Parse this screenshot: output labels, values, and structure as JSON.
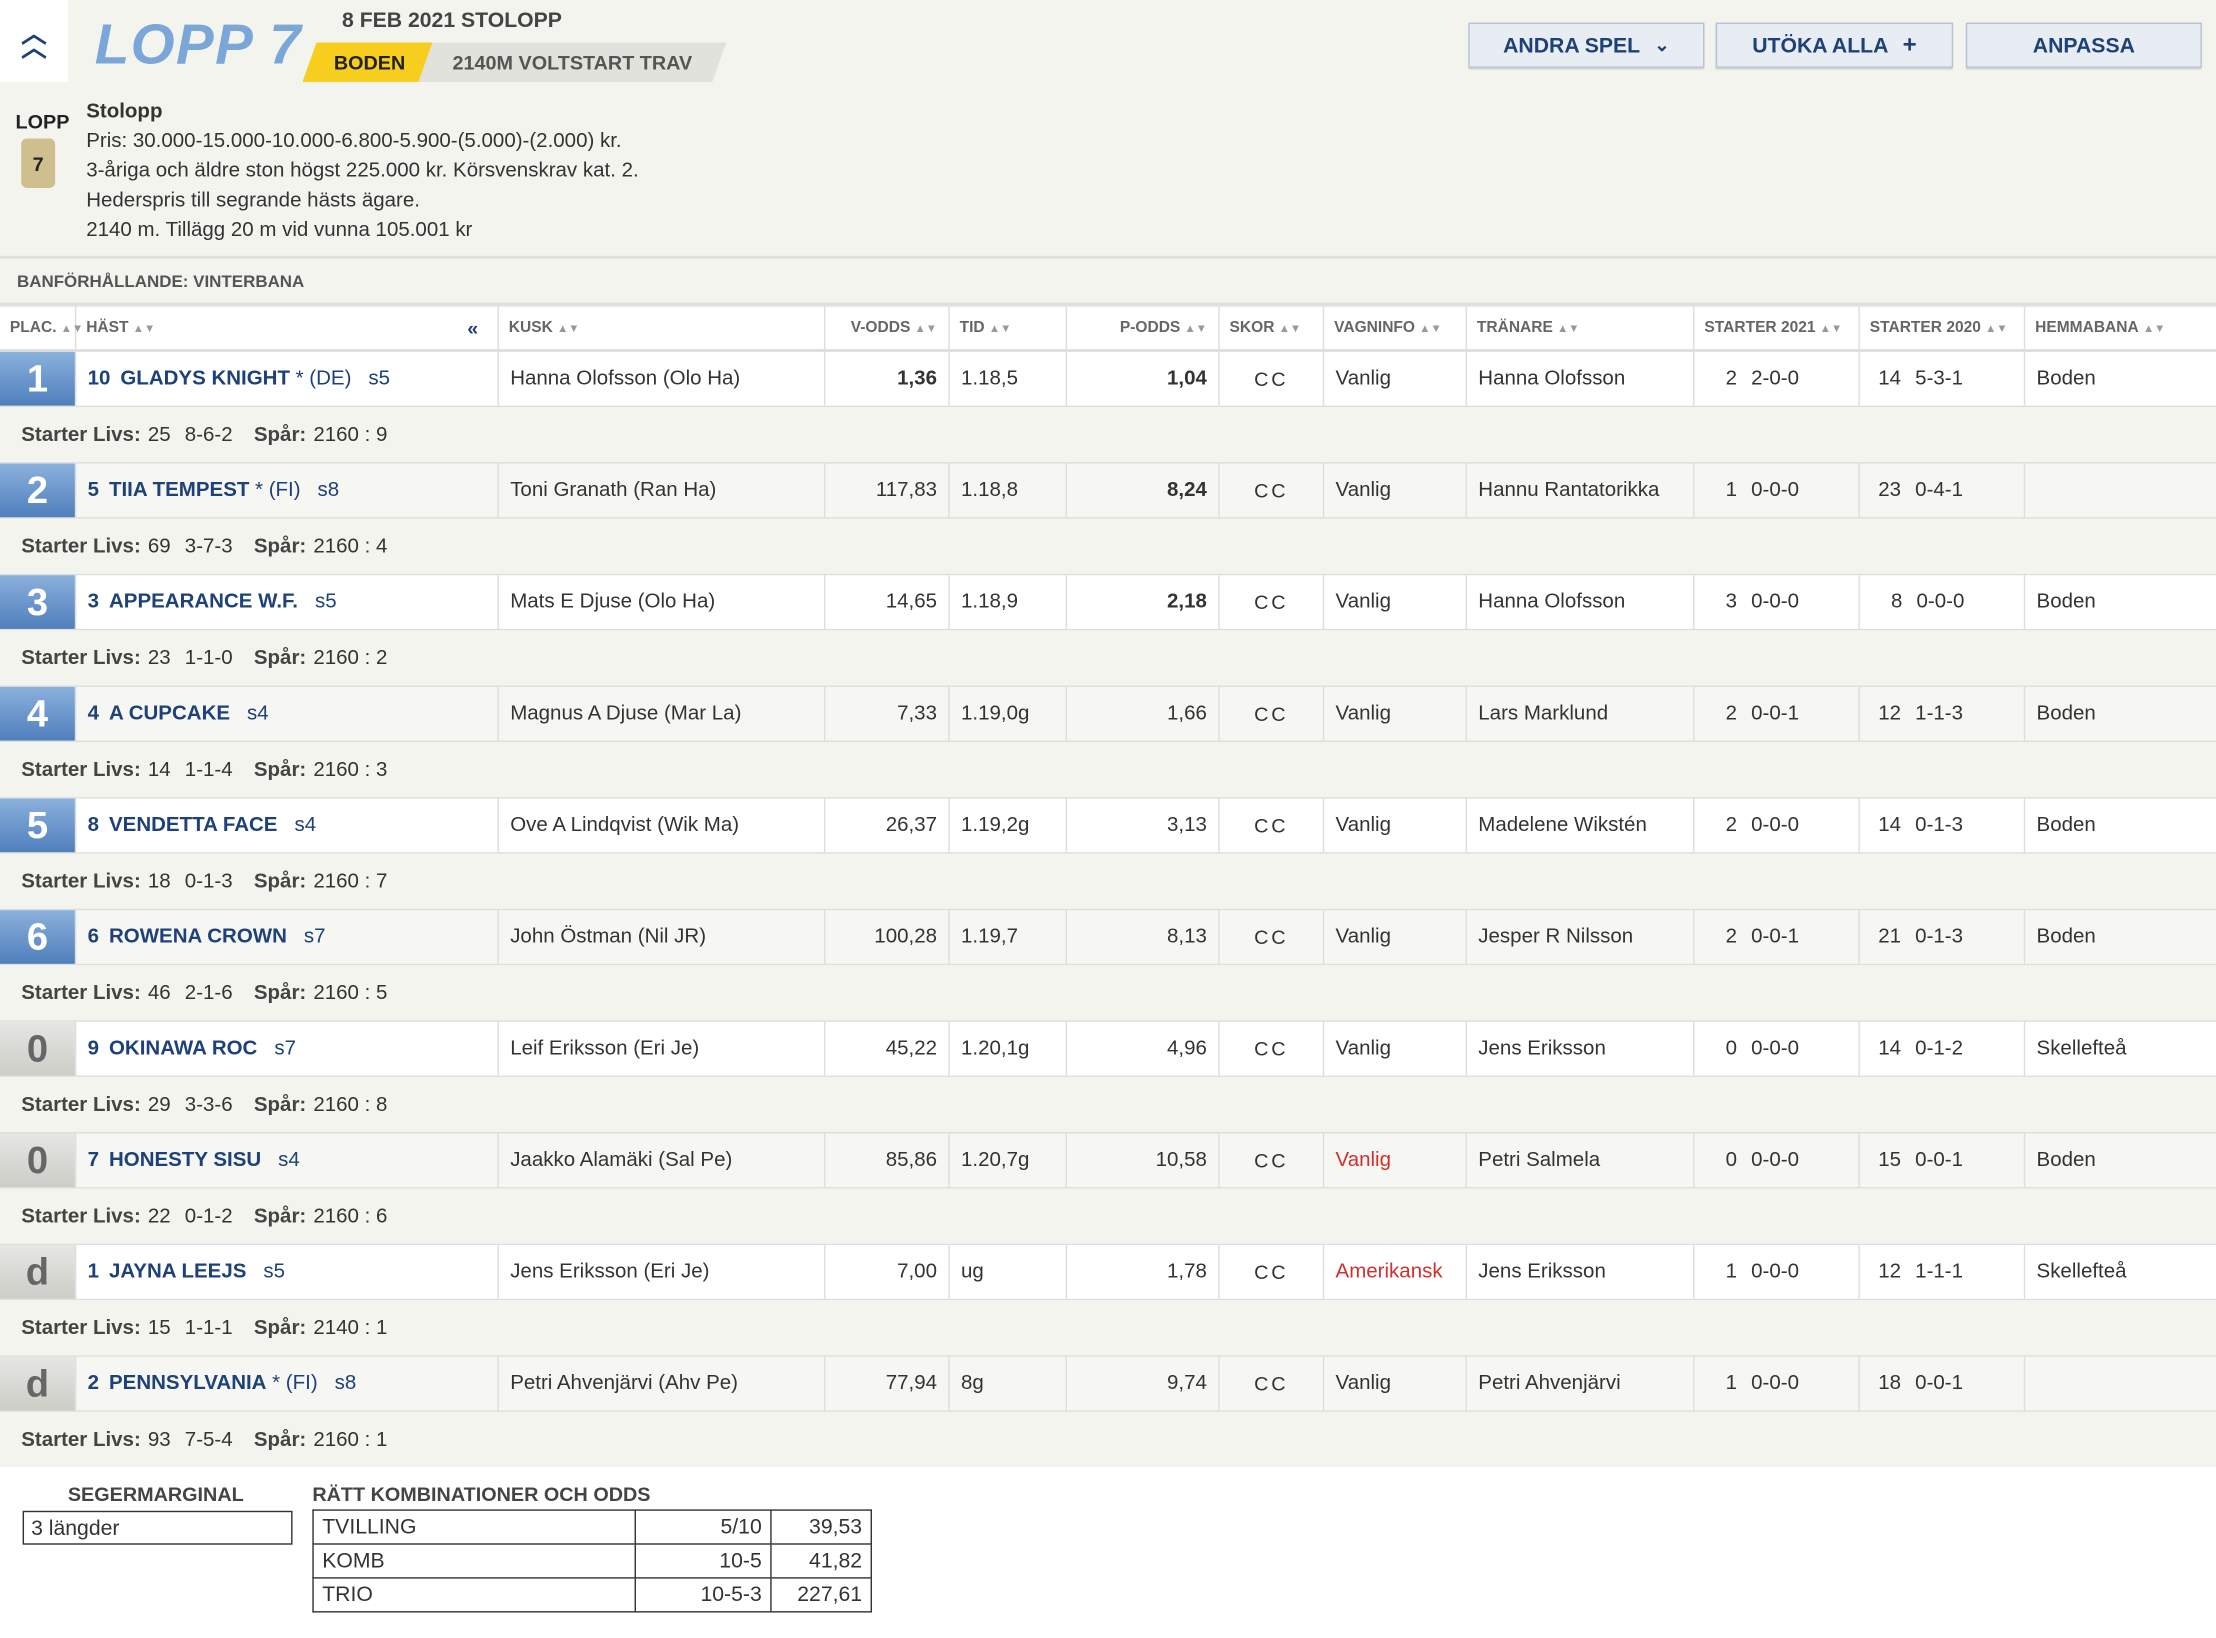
{
  "header": {
    "race_title": "LOPP 7",
    "date_type": "8 FEB 2021 STOLOPP",
    "track": "BODEN",
    "distance": "2140M VOLTSTART TRAV",
    "buttons": {
      "andra_spel": "ANDRA SPEL",
      "utoka_alla": "UTÖKA ALLA",
      "anpassa": "ANPASSA"
    }
  },
  "info": {
    "lopp_label": "LOPP",
    "lopp_number": "7",
    "lines": [
      "Stolopp",
      "Pris: 30.000-15.000-10.000-6.800-5.900-(5.000)-(2.000) kr.",
      "3-åriga och äldre ston högst 225.000 kr. Körsvenskrav kat. 2.",
      "Hederspris till segrande hästs ägare.",
      "2140 m. Tillägg 20 m vid vunna 105.001 kr"
    ]
  },
  "conditions": "BANFÖRHÅLLANDE: VINTERBANA",
  "columns": {
    "plac": "PLAC.",
    "hast": "HÄST",
    "collapse": "«",
    "kusk": "KUSK",
    "vodds": "V-ODDS",
    "tid": "TID",
    "podds": "P-ODDS",
    "skor": "SKOR",
    "vagninfo": "VAGNINFO",
    "tranare": "TRÄNARE",
    "starter2021": "STARTER 2021",
    "starter2020": "STARTER 2020",
    "hemmabana": "HEMMABANA"
  },
  "sub_labels": {
    "starter_livs": "Starter Livs:",
    "spar": "Spår:"
  },
  "rows": [
    {
      "plac": "1",
      "num": "10",
      "name": "GLADYS KNIGHT",
      "star": "*",
      "country": "(DE)",
      "age": "s5",
      "kusk": "Hanna Olofsson (Olo Ha)",
      "vodds": "1,36",
      "vodds_bold": true,
      "tid": "1.18,5",
      "podds": "1,04",
      "podds_bold": true,
      "skor": "CC",
      "vagn": "Vanlig",
      "vagn_red": false,
      "tranare": "Hanna Olofsson",
      "s21n": "2",
      "s21r": "2-0-0",
      "s20n": "14",
      "s20r": "5-3-1",
      "hemma": "Boden",
      "livs_n": "25",
      "livs_r": "8-6-2",
      "spar": "2160 : 9"
    },
    {
      "plac": "2",
      "num": "5",
      "name": "TIIA TEMPEST",
      "star": "*",
      "country": "(FI)",
      "age": "s8",
      "kusk": "Toni Granath (Ran Ha)",
      "vodds": "117,83",
      "vodds_bold": false,
      "tid": "1.18,8",
      "podds": "8,24",
      "podds_bold": true,
      "skor": "CC",
      "vagn": "Vanlig",
      "vagn_red": false,
      "tranare": "Hannu Rantatorikka",
      "s21n": "1",
      "s21r": "0-0-0",
      "s20n": "23",
      "s20r": "0-4-1",
      "hemma": "",
      "livs_n": "69",
      "livs_r": "3-7-3",
      "spar": "2160 : 4"
    },
    {
      "plac": "3",
      "num": "3",
      "name": "APPEARANCE W.F.",
      "star": "",
      "country": "",
      "age": "s5",
      "kusk": "Mats E Djuse (Olo Ha)",
      "vodds": "14,65",
      "vodds_bold": false,
      "tid": "1.18,9",
      "podds": "2,18",
      "podds_bold": true,
      "skor": "CC",
      "vagn": "Vanlig",
      "vagn_red": false,
      "tranare": "Hanna Olofsson",
      "s21n": "3",
      "s21r": "0-0-0",
      "s20n": "8",
      "s20r": "0-0-0",
      "hemma": "Boden",
      "livs_n": "23",
      "livs_r": "1-1-0",
      "spar": "2160 : 2"
    },
    {
      "plac": "4",
      "num": "4",
      "name": "A CUPCAKE",
      "star": "",
      "country": "",
      "age": "s4",
      "kusk": "Magnus A Djuse (Mar La)",
      "vodds": "7,33",
      "vodds_bold": false,
      "tid": "1.19,0g",
      "podds": "1,66",
      "podds_bold": false,
      "skor": "CC",
      "vagn": "Vanlig",
      "vagn_red": false,
      "tranare": "Lars Marklund",
      "s21n": "2",
      "s21r": "0-0-1",
      "s20n": "12",
      "s20r": "1-1-3",
      "hemma": "Boden",
      "livs_n": "14",
      "livs_r": "1-1-4",
      "spar": "2160 : 3"
    },
    {
      "plac": "5",
      "num": "8",
      "name": "VENDETTA FACE",
      "star": "",
      "country": "",
      "age": "s4",
      "kusk": "Ove A Lindqvist (Wik Ma)",
      "vodds": "26,37",
      "vodds_bold": false,
      "tid": "1.19,2g",
      "podds": "3,13",
      "podds_bold": false,
      "skor": "CC",
      "vagn": "Vanlig",
      "vagn_red": false,
      "tranare": "Madelene Wikstén",
      "s21n": "2",
      "s21r": "0-0-0",
      "s20n": "14",
      "s20r": "0-1-3",
      "hemma": "Boden",
      "livs_n": "18",
      "livs_r": "0-1-3",
      "spar": "2160 : 7"
    },
    {
      "plac": "6",
      "num": "6",
      "name": "ROWENA CROWN",
      "star": "",
      "country": "",
      "age": "s7",
      "kusk": "John Östman (Nil JR)",
      "vodds": "100,28",
      "vodds_bold": false,
      "tid": "1.19,7",
      "podds": "8,13",
      "podds_bold": false,
      "skor": "CC",
      "vagn": "Vanlig",
      "vagn_red": false,
      "tranare": "Jesper R Nilsson",
      "s21n": "2",
      "s21r": "0-0-1",
      "s20n": "21",
      "s20r": "0-1-3",
      "hemma": "Boden",
      "livs_n": "46",
      "livs_r": "2-1-6",
      "spar": "2160 : 5"
    },
    {
      "plac": "0",
      "num": "9",
      "name": "OKINAWA ROC",
      "star": "",
      "country": "",
      "age": "s7",
      "kusk": "Leif Eriksson (Eri Je)",
      "vodds": "45,22",
      "vodds_bold": false,
      "tid": "1.20,1g",
      "podds": "4,96",
      "podds_bold": false,
      "skor": "CC",
      "vagn": "Vanlig",
      "vagn_red": false,
      "tranare": "Jens Eriksson",
      "s21n": "0",
      "s21r": "0-0-0",
      "s20n": "14",
      "s20r": "0-1-2",
      "hemma": "Skellefteå",
      "livs_n": "29",
      "livs_r": "3-3-6",
      "spar": "2160 : 8"
    },
    {
      "plac": "0",
      "num": "7",
      "name": "HONESTY SISU",
      "star": "",
      "country": "",
      "age": "s4",
      "kusk": "Jaakko Alamäki (Sal Pe)",
      "vodds": "85,86",
      "vodds_bold": false,
      "tid": "1.20,7g",
      "podds": "10,58",
      "podds_bold": false,
      "skor": "CC",
      "vagn": "Vanlig",
      "vagn_red": true,
      "tranare": "Petri Salmela",
      "s21n": "0",
      "s21r": "0-0-0",
      "s20n": "15",
      "s20r": "0-0-1",
      "hemma": "Boden",
      "livs_n": "22",
      "livs_r": "0-1-2",
      "spar": "2160 : 6"
    },
    {
      "plac": "d",
      "num": "1",
      "name": "JAYNA LEEJS",
      "star": "",
      "country": "",
      "age": "s5",
      "kusk": "Jens Eriksson (Eri Je)",
      "vodds": "7,00",
      "vodds_bold": false,
      "tid": "ug",
      "podds": "1,78",
      "podds_bold": false,
      "skor": "CC",
      "vagn": "Amerikansk",
      "vagn_red": true,
      "tranare": "Jens Eriksson",
      "s21n": "1",
      "s21r": "0-0-0",
      "s20n": "12",
      "s20r": "1-1-1",
      "hemma": "Skellefteå",
      "livs_n": "15",
      "livs_r": "1-1-1",
      "spar": "2140 : 1"
    },
    {
      "plac": "d",
      "num": "2",
      "name": "PENNSYLVANIA",
      "star": "*",
      "country": "(FI)",
      "age": "s8",
      "kusk": "Petri Ahvenjärvi (Ahv Pe)",
      "vodds": "77,94",
      "vodds_bold": false,
      "tid": "8g",
      "podds": "9,74",
      "podds_bold": false,
      "skor": "CC",
      "vagn": "Vanlig",
      "vagn_red": false,
      "tranare": "Petri Ahvenjärvi",
      "s21n": "1",
      "s21r": "0-0-0",
      "s20n": "18",
      "s20r": "0-0-1",
      "hemma": "",
      "livs_n": "93",
      "livs_r": "7-5-4",
      "spar": "2160 : 1"
    }
  ],
  "footer": {
    "segermarginal_title": "SEGERMARGINAL",
    "segermarginal": "3 längder",
    "kombinationer_title": "RÄTT KOMBINATIONER OCH ODDS",
    "kombinationer": [
      {
        "type": "TVILLING",
        "combo": "5/10",
        "odds": "39,53"
      },
      {
        "type": "KOMB",
        "combo": "10-5",
        "odds": "41,82"
      },
      {
        "type": "TRIO",
        "combo": "10-5-3",
        "odds": "227,61"
      }
    ]
  },
  "colors": {
    "accent_blue": "#1d4178",
    "title_blue": "#7aa6d8",
    "track_yellow": "#f7cd1e",
    "red": "#d0312d"
  }
}
